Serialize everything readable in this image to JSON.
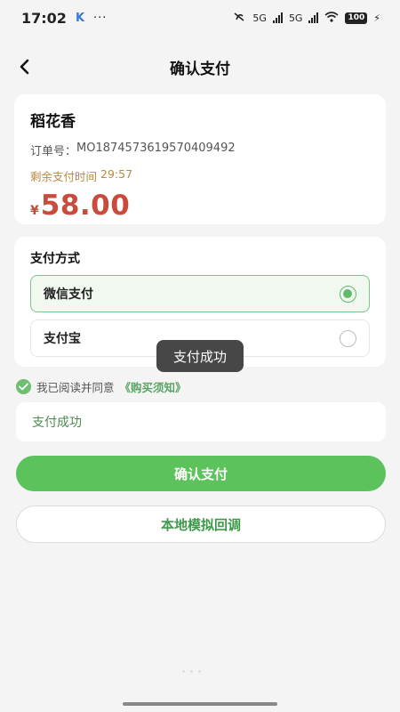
{
  "status_bar": {
    "time": "17:02",
    "app_badge": "K",
    "more": "···",
    "network_1": "5G",
    "network_2": "5G",
    "battery": "100"
  },
  "header": {
    "title": "确认支付"
  },
  "order": {
    "product_name": "稻花香",
    "order_no_label": "订单号：",
    "order_no": "MO1874573619570409492",
    "countdown_label": "剩余支付时间",
    "countdown": "29:57",
    "currency": "¥",
    "amount": "58.00"
  },
  "payment": {
    "heading": "支付方式",
    "options": [
      {
        "label": "微信支付",
        "selected": true
      },
      {
        "label": "支付宝",
        "selected": false
      }
    ]
  },
  "toast": {
    "text": "支付成功"
  },
  "agreement": {
    "text": "我已阅读并同意",
    "link": "《购买须知》",
    "checked": true
  },
  "result": {
    "text": "支付成功"
  },
  "actions": {
    "confirm_label": "确认支付",
    "mock_callback_label": "本地模拟回调"
  },
  "colors": {
    "accent_green": "#5bc25c",
    "price_red": "#c84b3c",
    "countdown_gold": "#b98a3e"
  }
}
